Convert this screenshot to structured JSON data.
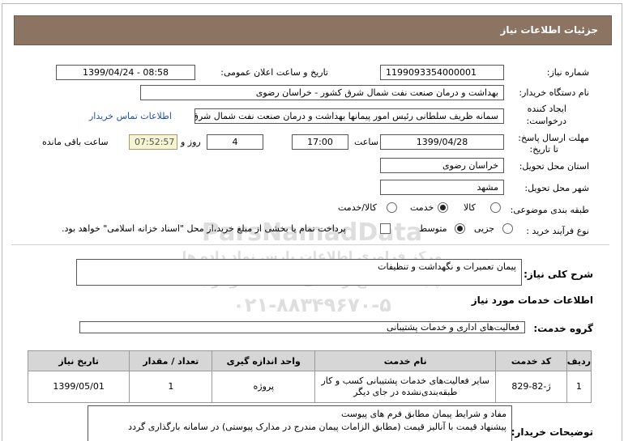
{
  "header": {
    "title": "جزئیات اطلاعات نیاز"
  },
  "fields": {
    "need_number_label": "شماره نیاز:",
    "need_number": "1199093354000001",
    "announce_label": "تاریخ و ساعت اعلان عمومی:",
    "announce_value": "1399/04/24 - 08:58",
    "buyer_label": "نام دستگاه خریدار:",
    "buyer_value": "بهداشت و درمان صنعت نفت شمال شرق کشور - خراسان رضوی",
    "creator_label_1": "ایجاد کننده",
    "creator_label_2": "درخواست:",
    "creator_value": "سمانه ظریف سلطانی رئیس امور پیمانها بهداشت و درمان صنعت نفت شمال شرق",
    "contact_link": "اطلاعات تماس خریدار",
    "deadline_label_1": "مهلت ارسال پاسخ:",
    "deadline_label_2": "تا تاریخ:",
    "deadline_date": "1399/04/28",
    "time_label": "ساعت",
    "deadline_time": "17:00",
    "days_value": "4",
    "day_and_label": "روز و",
    "remaining_time": "07:52:57",
    "remaining_label": "ساعت باقی مانده",
    "province_label": "استان محل تحویل:",
    "province_value": "خراسان رضوی",
    "city_label": "شهر محل تحویل:",
    "city_value": "مشهد",
    "category_label": "طبقه بندی موضوعی:",
    "category_options": [
      "کالا",
      "خدمت",
      "کالا/خدمت"
    ],
    "category_selected": "خدمت",
    "process_label": "نوع فرآیند خرید :",
    "process_options": [
      "جزیی",
      "متوسط"
    ],
    "process_selected": "متوسط",
    "treasury_note": "پرداخت تمام یا بخشی از مبلغ خرید،از محل \"اسناد خزانه اسلامی\" خواهد بود.",
    "treasury_checked": false
  },
  "summary": {
    "label": "شرح کلی نیاز:",
    "value": "پیمان تعمیرات و نگهداشت و تنظیفات"
  },
  "services_title": "اطلاعات خدمات مورد نیاز",
  "service_group": {
    "label": "گروه خدمت:",
    "value": "فعالیت‌های اداری و خدمات پشتیبانی"
  },
  "table": {
    "headers": [
      "ردیف",
      "کد خدمت",
      "نام خدمت",
      "واحد اندازه گیری",
      "تعداد / مقدار",
      "تاریخ نیاز"
    ],
    "rows": [
      {
        "row": "1",
        "code": "ژ-82-829",
        "name_1": "سایر فعالیت‌های خدمات پشتیبانی کسب و کار",
        "name_2": "طبقه‌بندی‌نشده در جای دیگر",
        "unit": "پروژه",
        "qty": "1",
        "date": "1399/05/01"
      }
    ]
  },
  "buyer_notes": {
    "label": "توضیحات خریدار:",
    "line_1": "مفاد و شرایط پیمان مطابق فرم های پیوست",
    "line_2": "پیشنهاد قیمت با آنالیز قیمت (مطابق الزامات پیمان مندرج در مدارک پیوستی) در سامانه بارگذاری گردد"
  },
  "watermark": {
    "line_1": "ParsNamadData",
    "line_2": "مرکز فراوری اطلاعات پارس نماد داده ها",
    "line_3": "پایگاه اطلاع رسانی مناقصه ومزایده",
    "line_4": "۰۲۱-۸۸۳۴۹۶۷۰-۵"
  }
}
